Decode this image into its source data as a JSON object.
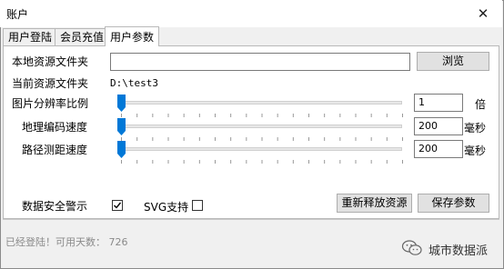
{
  "window": {
    "title": "账户",
    "close_glyph": "✕"
  },
  "tabs": [
    {
      "label": "用户登陆",
      "active": false
    },
    {
      "label": "会员充值",
      "active": false
    },
    {
      "label": "用户参数",
      "active": true
    }
  ],
  "form": {
    "local_folder": {
      "label": "本地资源文件夹",
      "value": "",
      "browse_button": "浏览"
    },
    "current_folder": {
      "label": "当前资源文件夹",
      "value": "D:\\test3"
    },
    "image_scale": {
      "label": "图片分辨率比例",
      "value": "1",
      "unit": "倍",
      "slider_level": 0
    },
    "geo_speed": {
      "label": "地理编码速度",
      "value": "200",
      "unit": "毫秒",
      "slider_level": 0
    },
    "route_speed": {
      "label": "路径测距速度",
      "value": "200",
      "unit": "毫秒",
      "slider_level": 0
    },
    "security_warning": {
      "label": "数据安全警示",
      "checked": true
    },
    "svg_support": {
      "label": "SVG支持",
      "checked": false
    },
    "release_button": "重新释放资源",
    "save_button": "保存参数"
  },
  "status": {
    "text": "已经登陆！可用天数：  726"
  },
  "watermark": {
    "text": "城市数据派",
    "icon": "wechat-icon"
  },
  "colors": {
    "slider_thumb": "#0078d7",
    "status_text": "#8a8a8a"
  }
}
